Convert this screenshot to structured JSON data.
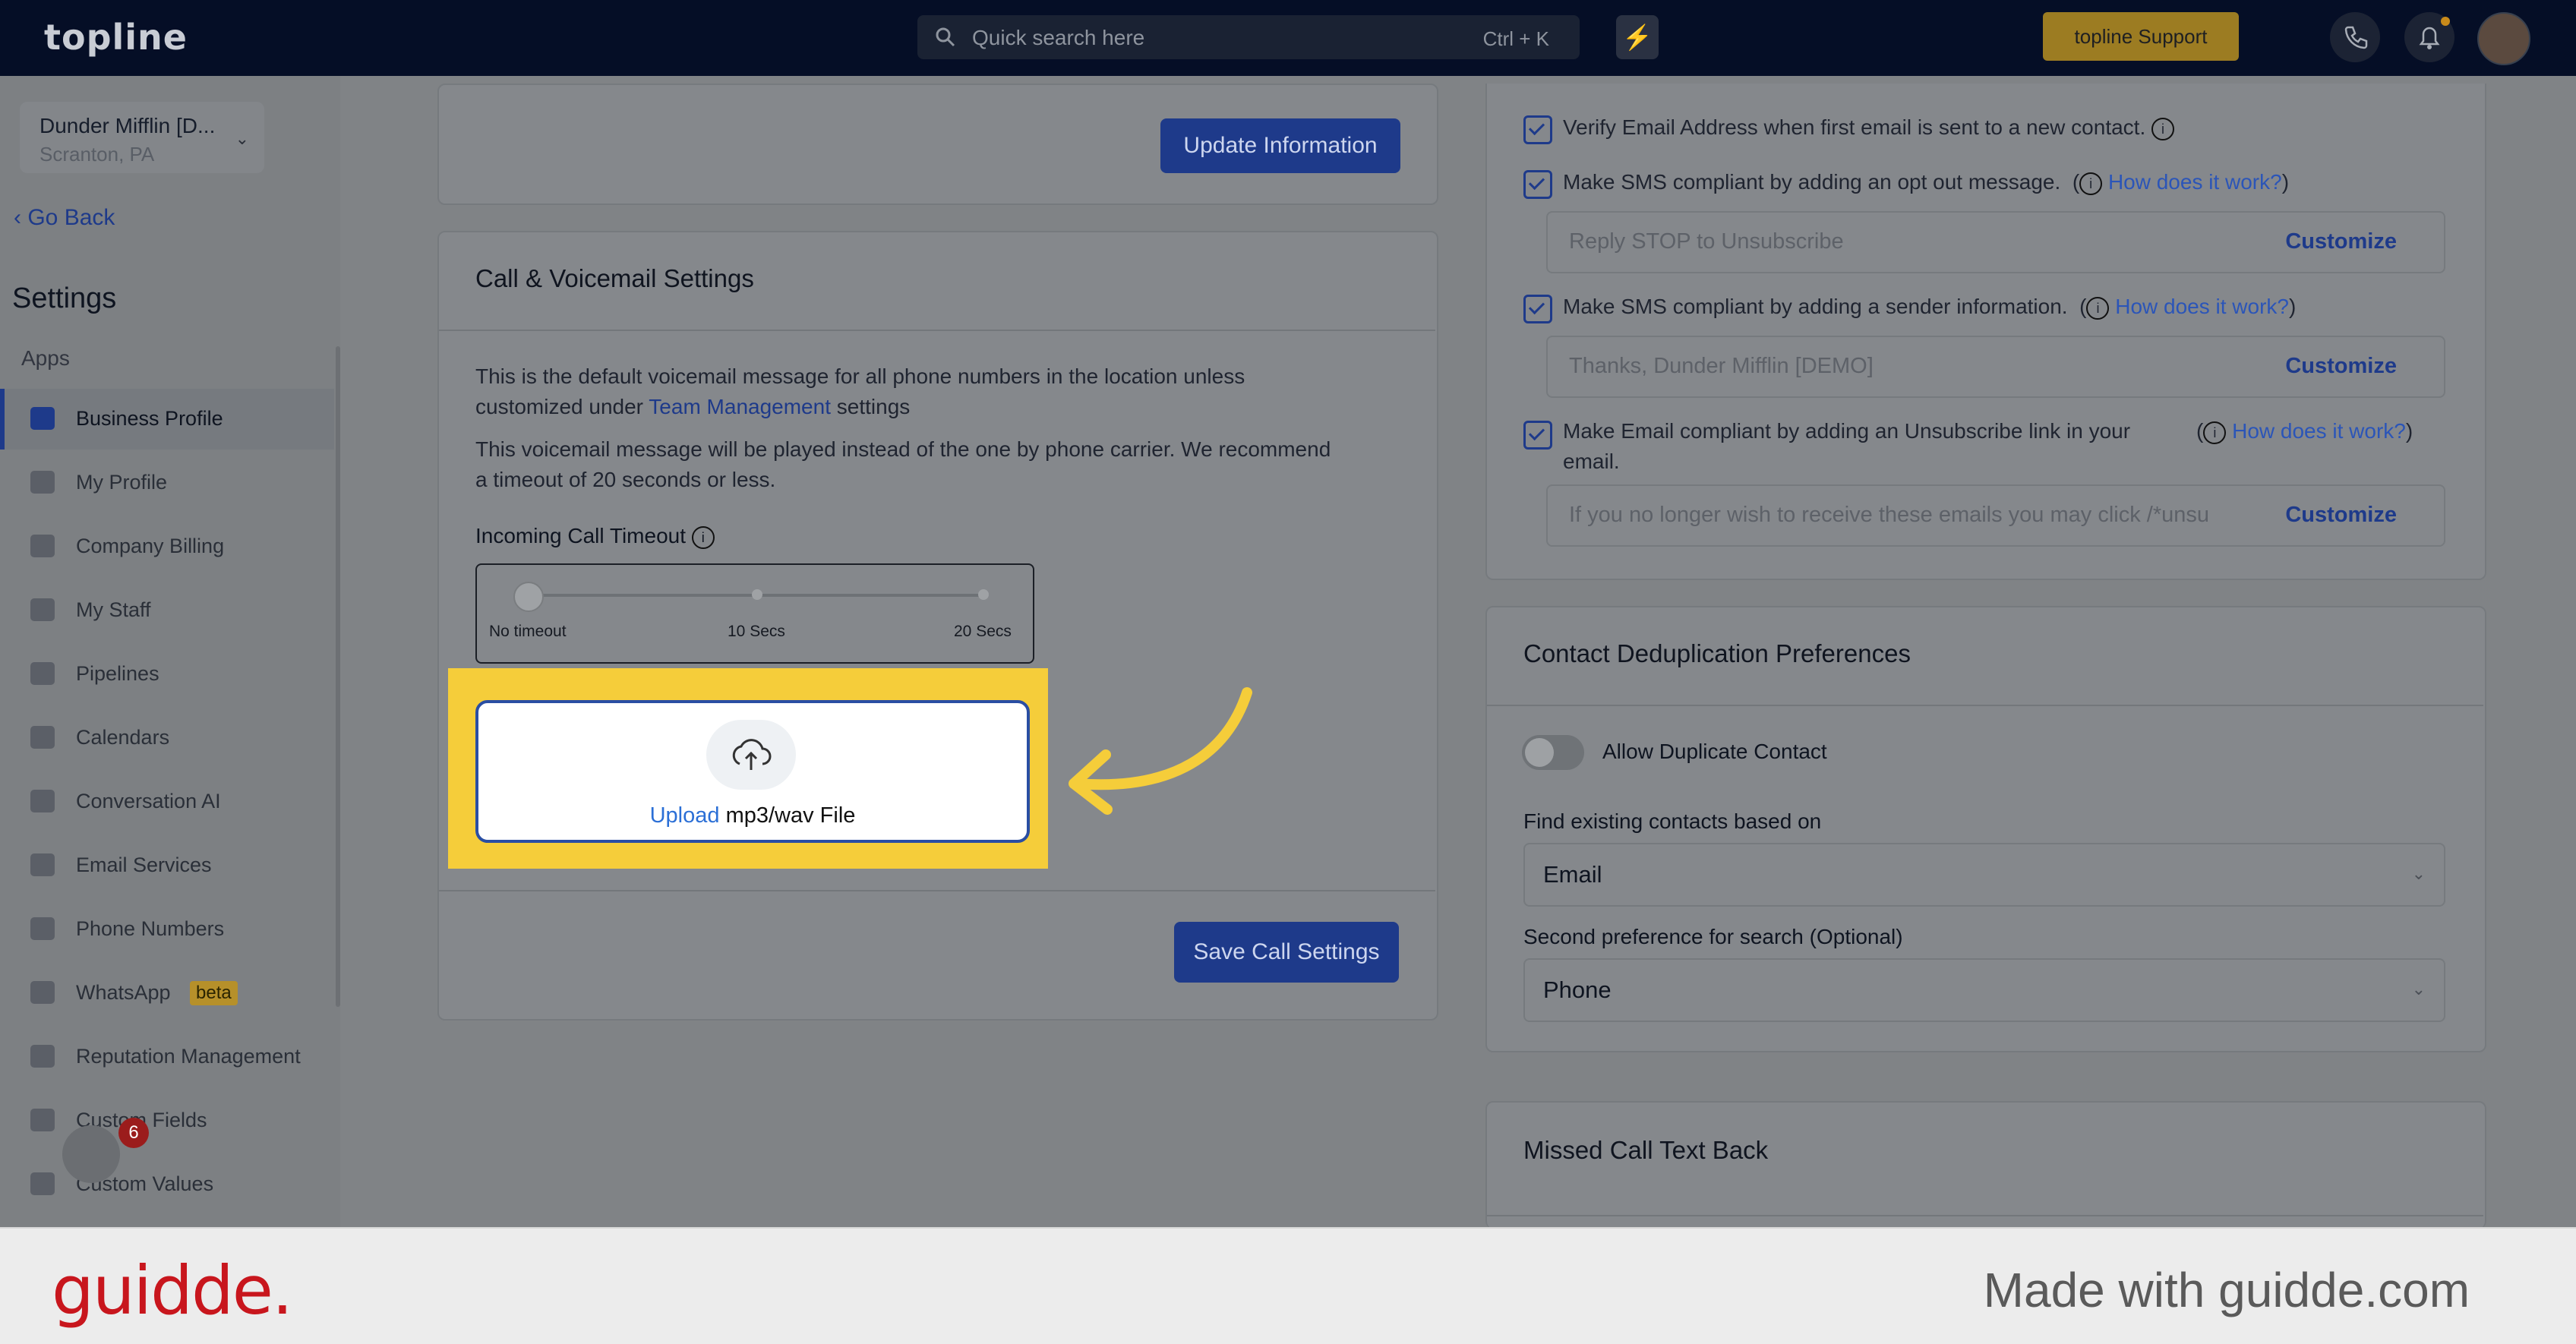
{
  "topbar": {
    "logo": "topline",
    "search_placeholder": "Quick search here",
    "search_shortcut": "Ctrl + K",
    "bolt_icon": "⚡",
    "support_label": "topline Support"
  },
  "sidebar": {
    "location_name": "Dunder Mifflin [D...",
    "location_city": "Scranton, PA",
    "go_back": "Go Back",
    "settings_title": "Settings",
    "section_label": "Apps",
    "items": [
      {
        "label": "Business Profile",
        "icon": "briefcase-icon",
        "active": true
      },
      {
        "label": "My Profile",
        "icon": "person-icon"
      },
      {
        "label": "Company Billing",
        "icon": "billing-icon"
      },
      {
        "label": "My Staff",
        "icon": "staff-icon"
      },
      {
        "label": "Pipelines",
        "icon": "pipeline-icon"
      },
      {
        "label": "Calendars",
        "icon": "calendar-icon"
      },
      {
        "label": "Conversation AI",
        "icon": "chat-icon"
      },
      {
        "label": "Email Services",
        "icon": "email-icon"
      },
      {
        "label": "Phone Numbers",
        "icon": "phone-icon"
      },
      {
        "label": "WhatsApp",
        "icon": "whatsapp-icon",
        "badge": "beta"
      },
      {
        "label": "Reputation Management",
        "icon": "star-icon"
      },
      {
        "label": "Custom Fields",
        "icon": "edit-icon"
      },
      {
        "label": "Custom Values",
        "icon": "values-icon"
      }
    ],
    "notification_count": "6"
  },
  "left_panel": {
    "update_button": "Update Information",
    "voicemail_title": "Call & Voicemail Settings",
    "desc1_a": "This is the default voicemail message for all phone numbers in the location unless",
    "desc1_b": "customized under",
    "desc1_link": "Team Management",
    "desc1_c": "settings",
    "desc2_a": "This voicemail message will be played instead of the one by phone carrier. We recommend",
    "desc2_b": "a timeout of 20 seconds or less.",
    "timeout_label": "Incoming Call Timeout",
    "slider_labels": [
      "No timeout",
      "10 Secs",
      "20 Secs"
    ],
    "slider_value": "No timeout",
    "upload_link": "Upload",
    "upload_text": "mp3/wav File",
    "save_button": "Save Call Settings"
  },
  "right_panel": {
    "verify_email": "Verify Email Address when first email is sent to a new contact.",
    "sms_optout": "Make SMS compliant by adding an opt out message.",
    "how_link": "How does it work?",
    "sms_optout_placeholder": "Reply STOP to Unsubscribe",
    "customize": "Customize",
    "sms_sender": "Make SMS compliant by adding a sender information.",
    "sms_sender_placeholder": "Thanks, Dunder Mifflin [DEMO]",
    "email_unsub_a": "Make Email compliant by adding an Unsubscribe link in your",
    "email_unsub_b": "email.",
    "email_unsub_placeholder": "If you no longer wish to receive these emails you may click /*unsu",
    "dedupe_title": "Contact Deduplication Preferences",
    "allow_duplicate": "Allow Duplicate Contact",
    "find_label": "Find existing contacts based on",
    "find_value": "Email",
    "second_label": "Second preference for search (Optional)",
    "second_value": "Phone",
    "missed_title": "Missed Call Text Back"
  },
  "footer": {
    "brand": "guidde.",
    "made_with": "Made with guidde.com"
  },
  "colors": {
    "accent": "#1e3a8a",
    "highlight": "#f5cd3a",
    "brand_red": "#c8161d"
  }
}
